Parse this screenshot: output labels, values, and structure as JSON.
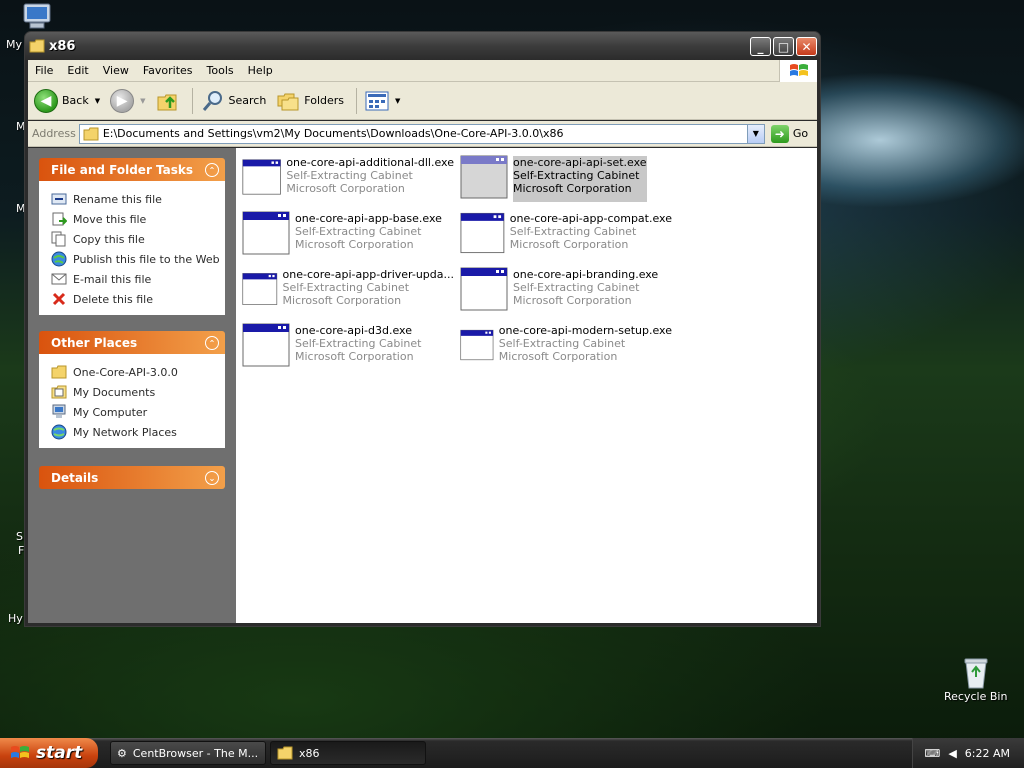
{
  "desktop": {
    "icons": [
      {
        "label": "My",
        "name": "my-computer"
      },
      {
        "label": "Recycle Bin",
        "name": "recycle-bin"
      }
    ],
    "peek_labels": [
      "M",
      "M",
      "S",
      "F",
      "Hy"
    ]
  },
  "window": {
    "title": "x86",
    "controls": {
      "minimize": "_",
      "maximize": "□",
      "close": "✕"
    }
  },
  "menu": [
    "File",
    "Edit",
    "View",
    "Favorites",
    "Tools",
    "Help"
  ],
  "toolbar": {
    "back": "Back",
    "search": "Search",
    "folders": "Folders"
  },
  "address": {
    "label": "Address",
    "path": "E:\\Documents and Settings\\vm2\\My Documents\\Downloads\\One-Core-API-3.0.0\\x86",
    "go": "Go"
  },
  "panels": {
    "file_tasks": {
      "title": "File and Folder Tasks",
      "items": [
        {
          "label": "Rename this file",
          "icon": "rename-icon"
        },
        {
          "label": "Move this file",
          "icon": "move-icon"
        },
        {
          "label": "Copy this file",
          "icon": "copy-icon"
        },
        {
          "label": "Publish this file to the Web",
          "icon": "publish-icon"
        },
        {
          "label": "E-mail this file",
          "icon": "email-icon"
        },
        {
          "label": "Delete this file",
          "icon": "delete-icon"
        }
      ]
    },
    "other_places": {
      "title": "Other Places",
      "items": [
        {
          "label": "One-Core-API-3.0.0",
          "icon": "folder-icon"
        },
        {
          "label": "My Documents",
          "icon": "documents-icon"
        },
        {
          "label": "My Computer",
          "icon": "computer-icon"
        },
        {
          "label": "My Network Places",
          "icon": "network-icon"
        }
      ]
    },
    "details": {
      "title": "Details"
    }
  },
  "files": [
    {
      "name": "one-core-api-additional-dll.exe",
      "type": "Self-Extracting Cabinet",
      "company": "Microsoft Corporation",
      "selected": false
    },
    {
      "name": "one-core-api-api-set.exe",
      "type": "Self-Extracting Cabinet",
      "company": "Microsoft Corporation",
      "selected": true
    },
    {
      "name": "one-core-api-app-base.exe",
      "type": "Self-Extracting Cabinet",
      "company": "Microsoft Corporation",
      "selected": false
    },
    {
      "name": "one-core-api-app-compat.exe",
      "type": "Self-Extracting Cabinet",
      "company": "Microsoft Corporation",
      "selected": false
    },
    {
      "name": "one-core-api-app-driver-upda...",
      "type": "Self-Extracting Cabinet",
      "company": "Microsoft Corporation",
      "selected": false
    },
    {
      "name": "one-core-api-branding.exe",
      "type": "Self-Extracting Cabinet",
      "company": "Microsoft Corporation",
      "selected": false
    },
    {
      "name": "one-core-api-d3d.exe",
      "type": "Self-Extracting Cabinet",
      "company": "Microsoft Corporation",
      "selected": false
    },
    {
      "name": "one-core-api-modern-setup.exe",
      "type": "Self-Extracting Cabinet",
      "company": "Microsoft Corporation",
      "selected": false
    }
  ],
  "taskbar": {
    "start": "start",
    "items": [
      {
        "label": "CentBrowser - The M...",
        "active": false
      },
      {
        "label": "x86",
        "active": true
      }
    ],
    "clock": "6:22 AM"
  }
}
